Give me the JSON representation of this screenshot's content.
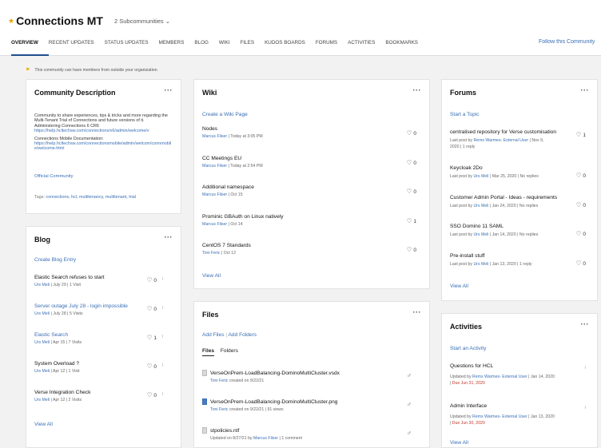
{
  "header": {
    "title": "Connections MT",
    "subcommunities": "2 Subcommunities",
    "follow": "Follow this Community"
  },
  "nav": [
    "OVERVIEW",
    "RECENT UPDATES",
    "STATUS UPDATES",
    "MEMBERS",
    "BLOG",
    "WIKI",
    "FILES",
    "KUDOS BOARDS",
    "FORUMS",
    "ACTIVITIES",
    "BOOKMARKS"
  ],
  "notice": "This community can have members from outside your organization.",
  "description": {
    "title": "Community Description",
    "more": "···",
    "intro": "Community to share experiences, tips & tricks and more regarding the Multi-Tenant Trial of Connections and future versions of it.",
    "admin_label": "Administering Connections 6 CR6",
    "admin_url": "https://help.hcltechsw.com/connections/v6/admin/welcome/v",
    "mobile_label": "Connections Mobile Documentation:",
    "mobile_url": "https://help.hcltechsw.com/connectionsmobile/admin/welcom/connmobile/welcome.html",
    "official": "Official Community",
    "tags_label": "Tags:",
    "tags": "connections, hcl, multitenancy, multitenant, trial"
  },
  "blog": {
    "title": "Blog",
    "more": "···",
    "create": "Create Blog Entry",
    "view_all": "View All",
    "entries": [
      {
        "title": "Elastic Search refuses to start",
        "author": "Urs Meli",
        "meta": "July 29",
        "visits": "1 Visit",
        "likes": "0",
        "linked": false
      },
      {
        "title": "Server outage July 28 - login impossible",
        "author": "Urs Meli",
        "meta": "July 28",
        "visits": "5 Visits",
        "likes": "0",
        "linked": true
      },
      {
        "title": "Elastic Search",
        "author": "Urs Meli",
        "meta": "Apr 15",
        "visits": "7 Visits",
        "likes": "1",
        "linked": true
      },
      {
        "title": "System Overload ?",
        "author": "Urs Meli",
        "meta": "Apr 12",
        "visits": "1 Visit",
        "likes": "0",
        "linked": false
      },
      {
        "title": "Verse Integration Check",
        "author": "Urs Meli",
        "meta": "Apr 12",
        "visits": "2 Visits",
        "likes": "0",
        "linked": false
      }
    ]
  },
  "wiki": {
    "title": "Wiki",
    "more": "···",
    "create": "Create a Wiki Page",
    "view_all": "View All",
    "pages": [
      {
        "title": "Nodes",
        "author": "Marcus Filser",
        "date": "Today at 3:05 PM",
        "likes": "0"
      },
      {
        "title": "CC Meetings EU",
        "author": "Marcus Filser",
        "date": "Today at 2:54 PM",
        "likes": "0"
      },
      {
        "title": "Additional namespace",
        "author": "Marcus Filser",
        "date": "Oct 15",
        "likes": "0"
      },
      {
        "title": "Prominic GBAuth on Linux natively",
        "author": "Marcus Filser",
        "date": "Oct 14",
        "likes": "1"
      },
      {
        "title": "CentOS 7 Standards",
        "author": "Toni Feric",
        "date": "Oct 12",
        "likes": "0"
      }
    ]
  },
  "files": {
    "title": "Files",
    "more": "···",
    "add_files": "Add Files",
    "add_folders": "Add Folders",
    "tab_files": "Files",
    "tab_folders": "Folders",
    "items": [
      {
        "name": "VerseOnPrem-LoadBalancing-DominoMultiCluster.vsdx",
        "author": "Toni Feric",
        "meta": "created on 9/22/21",
        "extra": "",
        "icon": "doc"
      },
      {
        "name": "VerseOnPrem-LoadBalancing-DominoMultiCluster.png",
        "author": "Toni Feric",
        "meta": "created on 9/22/21",
        "extra": "91 views",
        "icon": "image"
      },
      {
        "name": "stpolicies.ntf",
        "author": "Marcus Filser",
        "meta": "Updated on 8/27/21 by",
        "extra": "1 comment",
        "icon": "doc"
      }
    ]
  },
  "forums": {
    "title": "Forums",
    "more": "···",
    "start": "Start a Topic",
    "view_all": "View All",
    "topics": [
      {
        "title": "centralised repository for Verse customisation",
        "line1": "Last post by",
        "author": "Rems Warmes- External User",
        "date": "Nov 9,",
        "line2": "2020 | 1 reply",
        "likes": "1"
      },
      {
        "title": "Keycloak 2Do",
        "line1": "Last post by",
        "author": "Urs Meli",
        "date": "Mar 25, 2020 | No replies",
        "line2": "",
        "likes": "0"
      },
      {
        "title": "Customer Admin Portal - Ideas - requirements",
        "line1": "Last post by",
        "author": "Urs Meli",
        "date": "Jan 24, 2020 | No replies",
        "line2": "",
        "likes": "0"
      },
      {
        "title": "SSO Domino 11 SAML",
        "line1": "Last post by",
        "author": "Urs Meli",
        "date": "Jan 14, 2020 | No replies",
        "line2": "",
        "likes": "0"
      },
      {
        "title": "Pre-install stuff",
        "line1": "Last post by",
        "author": "Urs Meli",
        "date": "Jan 13, 2020 | 1 reply",
        "line2": "",
        "likes": "0"
      }
    ]
  },
  "activities": {
    "title": "Activities",
    "more": "···",
    "start": "Start an Activity",
    "view_all": "View All",
    "items": [
      {
        "title": "Questions for HCL",
        "updated": "Updated by",
        "author": "Rems Warmes- External User",
        "date": "Jan 14, 2020",
        "due": "Due Jun 31, 2020"
      },
      {
        "title": "Admin Interface",
        "updated": "Updated by",
        "author": "Rems Warmes- External User",
        "date": "Jan 13, 2020",
        "due": "Due Jun 30, 2020"
      }
    ]
  }
}
